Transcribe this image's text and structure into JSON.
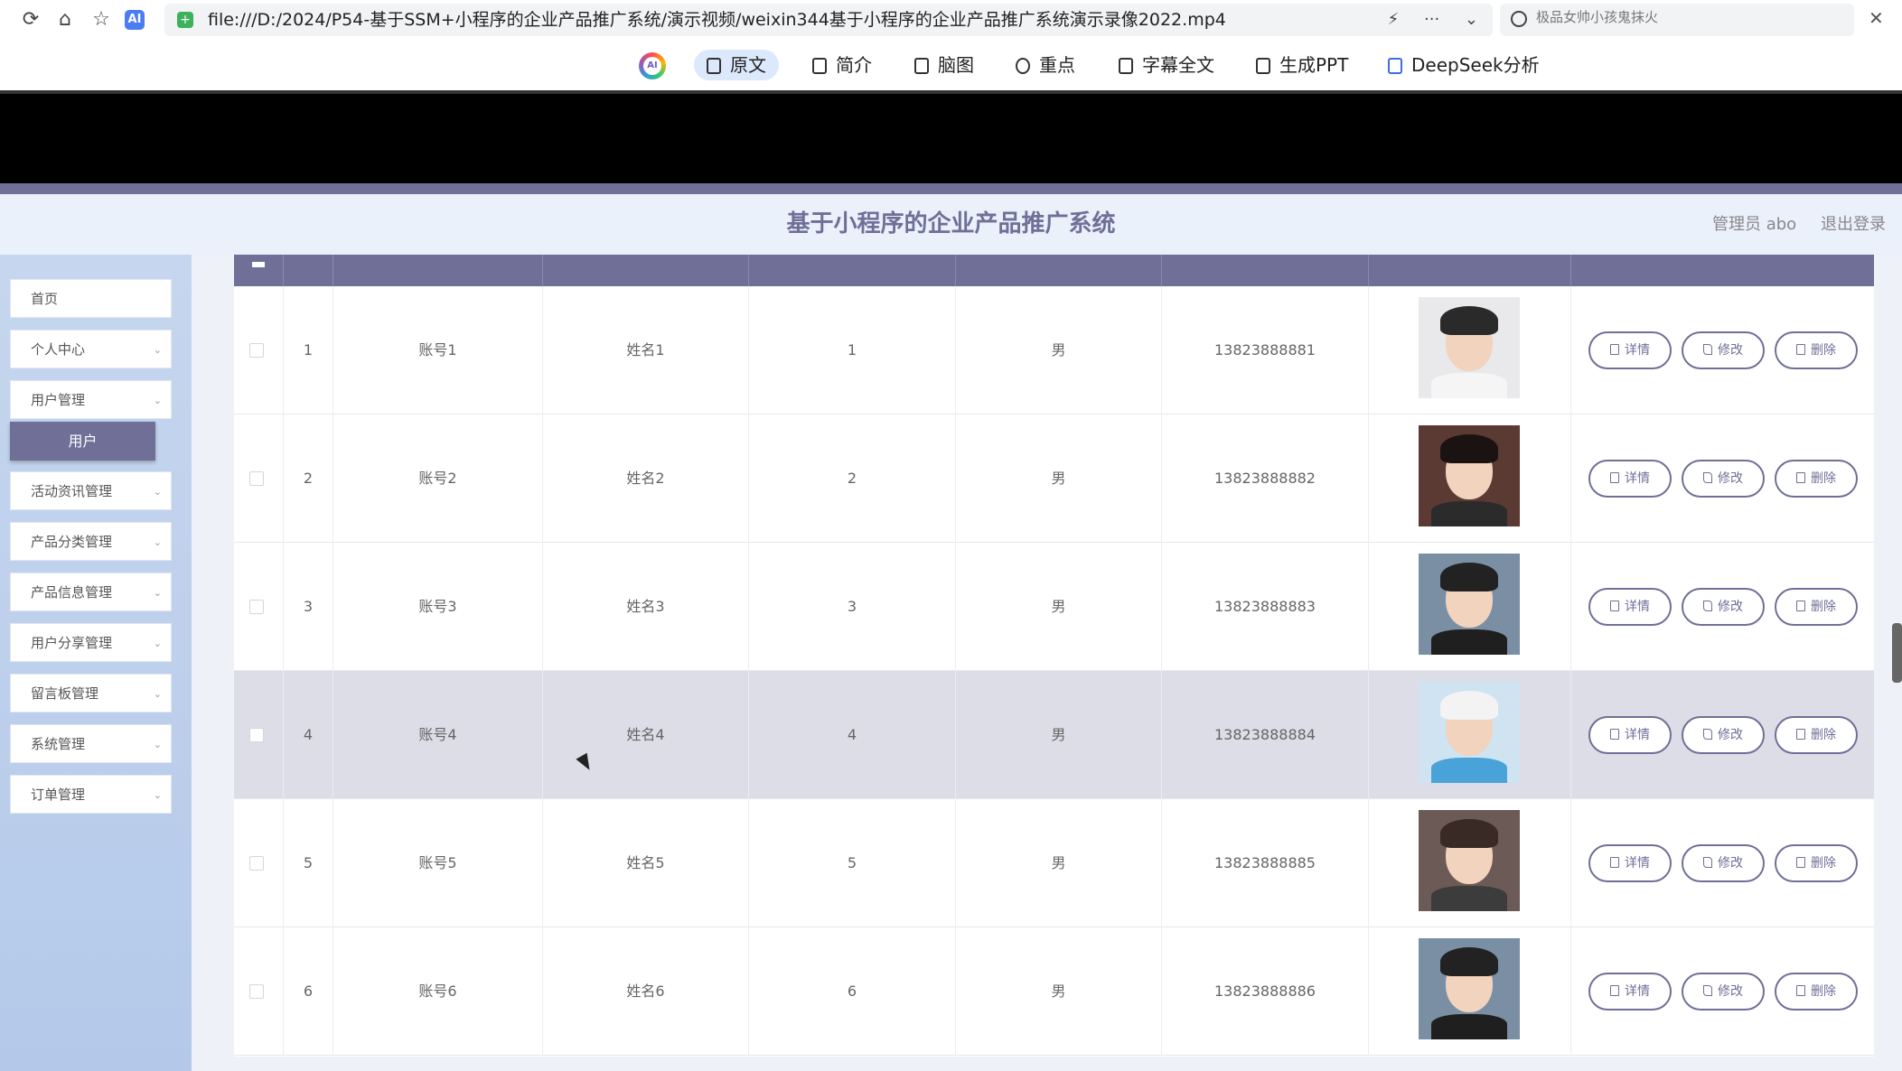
{
  "browser": {
    "url": "file:///D:/2024/P54-基于SSM+小程序的企业产品推广系统/演示视频/weixin344基于小程序的企业产品推广系统演示录像2022.mp4",
    "search_placeholder": "极品女帅小孩鬼抹火",
    "ai_tabs": [
      "原文",
      "简介",
      "脑图",
      "重点",
      "字幕全文",
      "生成PPT",
      "DeepSeek分析"
    ],
    "active_tab": "原文"
  },
  "app": {
    "title": "基于小程序的企业产品推广系统",
    "admin_label": "管理员 abo",
    "logout_label": "退出登录"
  },
  "sidebar": {
    "items": [
      "首页",
      "个人中心",
      "用户管理",
      "活动资讯管理",
      "产品分类管理",
      "产品信息管理",
      "用户分享管理",
      "留言板管理",
      "系统管理",
      "订单管理"
    ],
    "active_submenu": "用户"
  },
  "table": {
    "rows": [
      {
        "index": "1",
        "account": "账号1",
        "name": "姓名1",
        "age": "1",
        "gender": "男",
        "phone": "13823888881",
        "avatar": "young-man-white-shirt"
      },
      {
        "index": "2",
        "account": "账号2",
        "name": "姓名2",
        "age": "2",
        "gender": "男",
        "phone": "13823888882",
        "avatar": "woman-dark-hair"
      },
      {
        "index": "3",
        "account": "账号3",
        "name": "姓名3",
        "age": "3",
        "gender": "男",
        "phone": "13823888883",
        "avatar": "young-man-black-shirt"
      },
      {
        "index": "4",
        "account": "账号4",
        "name": "姓名4",
        "age": "4",
        "gender": "男",
        "phone": "13823888884",
        "avatar": "woman-white-cap"
      },
      {
        "index": "5",
        "account": "账号5",
        "name": "姓名5",
        "age": "5",
        "gender": "男",
        "phone": "13823888885",
        "avatar": "woman-long-hair-scarf"
      },
      {
        "index": "6",
        "account": "账号6",
        "name": "姓名6",
        "age": "6",
        "gender": "男",
        "phone": "13823888886",
        "avatar": "young-man-black-shirt"
      }
    ],
    "actions": {
      "detail": "详情",
      "edit": "修改",
      "delete": "删除"
    },
    "hover_row": 4
  },
  "colors": {
    "theme": "#6f6f98",
    "header_bg": "#eaf1fb",
    "sidebar_bg": "#c6d6ee"
  }
}
